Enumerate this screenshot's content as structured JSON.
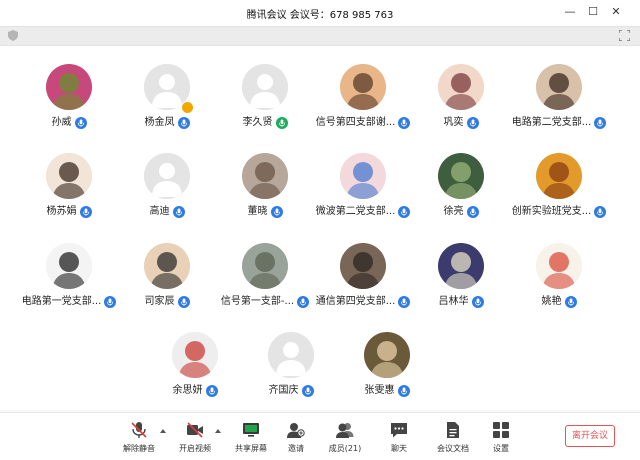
{
  "window": {
    "title": "腾讯会议 会议号：678 985 763",
    "controls": [
      "minimize-icon",
      "maximize-icon",
      "close-icon"
    ]
  },
  "infobar": {
    "left_icon": "shield-icon",
    "right_icon": "fullscreen-icon"
  },
  "participants": [
    {
      "name": "孙威",
      "avatar": "photo-flowers",
      "mic": "mic-icon"
    },
    {
      "name": "杨金凤",
      "avatar": "default-person",
      "mic": "mic-icon",
      "host": true
    },
    {
      "name": "李久贤",
      "avatar": "default-person",
      "mic": "mic-speaking-icon"
    },
    {
      "name": "信号第四支部谢...",
      "avatar": "photo-anime",
      "mic": "mic-icon"
    },
    {
      "name": "巩奕",
      "avatar": "photo-anime-girl",
      "mic": "mic-icon"
    },
    {
      "name": "电路第二党支部...",
      "avatar": "photo-portrait",
      "mic": "mic-icon"
    },
    {
      "name": "杨苏娟",
      "avatar": "photo-cartoon-princess",
      "mic": "mic-icon"
    },
    {
      "name": "高迪",
      "avatar": "default-person",
      "mic": "mic-icon"
    },
    {
      "name": "董晓",
      "avatar": "photo-cat",
      "mic": "mic-icon"
    },
    {
      "name": "微波第二党支部...",
      "avatar": "photo-drawing",
      "mic": "mic-icon"
    },
    {
      "name": "徐亮",
      "avatar": "photo-leaves",
      "mic": "mic-icon"
    },
    {
      "name": "创新实验班党支...",
      "avatar": "photo-lion",
      "mic": "mic-icon"
    },
    {
      "name": "电路第一党支部...",
      "avatar": "photo-cartoon-mask",
      "mic": "mic-icon"
    },
    {
      "name": "司家辰",
      "avatar": "photo-cartoon-boy",
      "mic": "mic-icon"
    },
    {
      "name": "信号第一支部-...",
      "avatar": "photo-street",
      "mic": "mic-icon"
    },
    {
      "name": "通信第四党支部...",
      "avatar": "photo-desk",
      "mic": "mic-icon"
    },
    {
      "name": "吕林华",
      "avatar": "photo-moon",
      "mic": "mic-icon"
    },
    {
      "name": "姚艳",
      "avatar": "photo-sticker",
      "mic": "mic-icon"
    },
    {
      "name": "余思妍",
      "avatar": "photo-red-doll",
      "mic": "mic-icon"
    },
    {
      "name": "齐国庆",
      "avatar": "default-person",
      "mic": "mic-icon"
    },
    {
      "name": "张雯惠",
      "avatar": "photo-child",
      "mic": "mic-icon"
    }
  ],
  "toolbar": {
    "unmute": {
      "label": "解除静音",
      "icon": "mic-muted-icon"
    },
    "video": {
      "label": "开启视频",
      "icon": "camera-off-icon"
    },
    "share": {
      "label": "共享屏幕",
      "icon": "screen-share-icon"
    },
    "invite": {
      "label": "邀请",
      "icon": "add-person-icon"
    },
    "members": {
      "label": "成员(21)",
      "icon": "members-icon"
    },
    "chat": {
      "label": "聊天",
      "icon": "chat-icon"
    },
    "docs": {
      "label": "会议文档",
      "icon": "document-icon"
    },
    "settings": {
      "label": "设置",
      "icon": "settings-icon"
    },
    "leave": {
      "label": "离开会议"
    }
  },
  "colors": {
    "accent": "#2f7be5",
    "speaking": "#1aad5a",
    "leave": "#e25555",
    "host": "#f0a800"
  }
}
